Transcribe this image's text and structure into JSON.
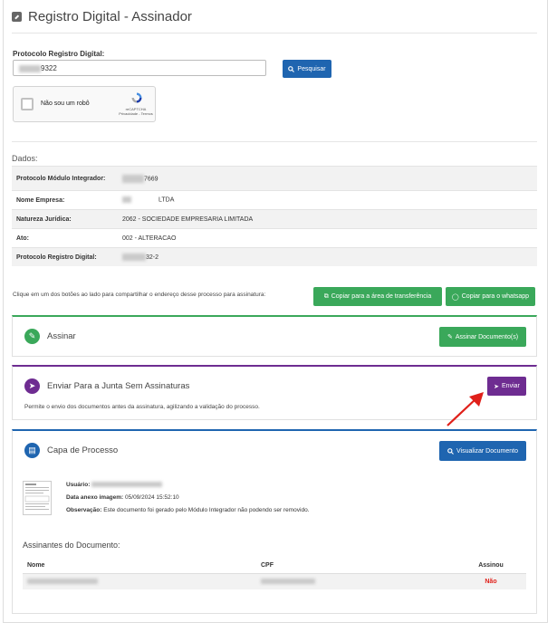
{
  "header": {
    "title": "Registro Digital - Assinador"
  },
  "search": {
    "label": "Protocolo Registro Digital:",
    "value": "9322",
    "button_label": "Pesquisar"
  },
  "captcha": {
    "label": "Não sou um robô",
    "brand": "reCAPTCHA",
    "links": "Privacidade - Termos"
  },
  "dados": {
    "title": "Dados:",
    "rows": [
      {
        "key": "Protocolo Módulo Integrador:",
        "value": "7669"
      },
      {
        "key": "Nome Empresa:",
        "value": "LTDA"
      },
      {
        "key": "Natureza Jurídica:",
        "value": "2062 - SOCIEDADE EMPRESARIA LIMITADA"
      },
      {
        "key": "Ato:",
        "value": "002 - ALTERACAO"
      },
      {
        "key": "Protocolo Registro Digital:",
        "value": "32-2"
      }
    ]
  },
  "share": {
    "text": "Clique em um dos botões ao lado para compartilhar o endereço desse processo para assinatura:",
    "copy_clipboard": "Copiar para a área de transferência",
    "copy_whatsapp": "Copiar para o whatsapp"
  },
  "assinar": {
    "title": "Assinar",
    "button_label": "Assinar Documento(s)"
  },
  "enviar": {
    "title": "Enviar Para a Junta Sem Assinaturas",
    "button_label": "Enviar",
    "description": "Permite o envio dos documentos antes da assinatura, agilizando a validação do processo."
  },
  "capa": {
    "title": "Capa de Processo",
    "button_label": "Visualizar Documento",
    "usuario_label": "Usuário:",
    "data_label": "Data anexo imagem:",
    "data_value": "05/09/2024 15:52:10",
    "obs_label": "Observação:",
    "obs_value": "Este documento foi gerado pelo Módulo Integrador não podendo ser removido."
  },
  "assinantes": {
    "title": "Assinantes do Documento:",
    "columns": [
      "Nome",
      "CPF",
      "Assinou"
    ],
    "rows": [
      {
        "assinou": "Não"
      }
    ]
  },
  "colors": {
    "green": "#3aa85a",
    "purple": "#6e2c91",
    "blue": "#1f65b0",
    "red": "#e0201a"
  }
}
